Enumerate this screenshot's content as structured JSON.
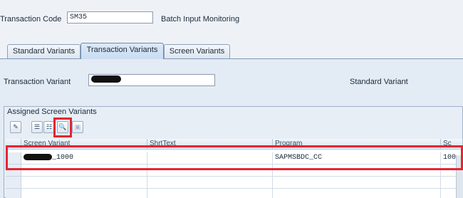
{
  "header": {
    "transaction_code_label": "Transaction Code",
    "transaction_code_value": "SM35",
    "transaction_description": "Batch Input Monitoring"
  },
  "tabs": [
    {
      "label": "Standard Variants"
    },
    {
      "label": "Transaction Variants"
    },
    {
      "label": "Screen Variants"
    }
  ],
  "form": {
    "variant_label": "Transaction Variant",
    "variant_type": "Standard Variant"
  },
  "group": {
    "title": "Assigned Screen Variants"
  },
  "toolbar": {
    "icons": [
      "edit-icon",
      "insert-row-icon",
      "delete-row-icon",
      "details-icon",
      "save-icon"
    ]
  },
  "table": {
    "columns": [
      "Screen Variant",
      "ShrtText",
      "Program",
      "Sc"
    ],
    "rows": [
      {
        "screen_variant_suffix": "_1000",
        "short_text": "",
        "program": "SAPMSBDC_CC",
        "screen": "100"
      }
    ]
  },
  "colors": {
    "highlight": "#e32634",
    "active_tab": "#c9dcf0"
  }
}
